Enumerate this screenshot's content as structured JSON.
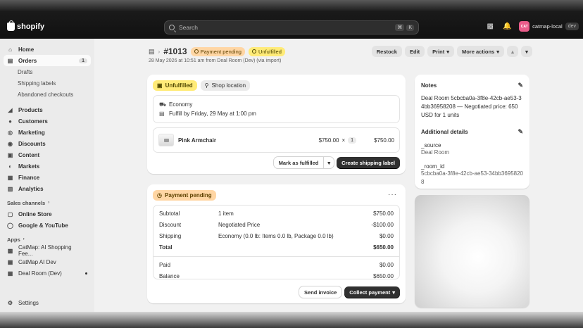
{
  "topbar": {
    "brand": "shopify",
    "search_placeholder": "Search",
    "search_kbd_1": "⌘",
    "search_kbd_2": "K",
    "avatar_initials": "CAT",
    "store_name": "catmap-local",
    "store_badge": "dev"
  },
  "sidebar": {
    "home": "Home",
    "orders": "Orders",
    "orders_count": "1",
    "drafts": "Drafts",
    "shipping_labels": "Shipping labels",
    "abandoned_checkouts": "Abandoned checkouts",
    "products": "Products",
    "customers": "Customers",
    "marketing": "Marketing",
    "discounts": "Discounts",
    "content": "Content",
    "markets": "Markets",
    "finance": "Finance",
    "analytics": "Analytics",
    "sales_channels": "Sales channels",
    "online_store": "Online Store",
    "google_youtube": "Google & YouTube",
    "apps": "Apps",
    "app_1": "CatMap: AI Shopping Fee...",
    "app_2": "CatMap AI Dev",
    "app_3": "Deal Room (Dev)",
    "settings": "Settings"
  },
  "order": {
    "number": "#1013",
    "payment_badge": "Payment pending",
    "fulfillment_badge": "Unfulfilled",
    "meta": "28 May 2026 at 10:51 am from Deal Room (Dev) (via import)"
  },
  "header_actions": {
    "restock": "Restock",
    "edit": "Edit",
    "print": "Print",
    "more_actions": "More actions"
  },
  "fulfillment": {
    "status": "Unfulfilled",
    "location": "Shop location",
    "shipping_method": "Economy",
    "fulfill_by": "Fulfill by Friday, 29 May at 1:00 pm",
    "item_name": "Pink Armchair",
    "item_price": "$750.00",
    "times": "×",
    "item_qty": "1",
    "item_total": "$750.00",
    "mark_fulfilled": "Mark as fulfilled",
    "create_label": "Create shipping label"
  },
  "payment": {
    "status": "Payment pending",
    "rows": [
      {
        "label": "Subtotal",
        "detail": "1 item",
        "amount": "$750.00"
      },
      {
        "label": "Discount",
        "detail": "Negotiated Price",
        "amount": "-$100.00"
      },
      {
        "label": "Shipping",
        "detail": "Economy (0.0 lb: Items 0.0 lb, Package 0.0 lb)",
        "amount": "$0.00"
      },
      {
        "label": "Total",
        "detail": "",
        "amount": "$650.00"
      }
    ],
    "paid_label": "Paid",
    "paid_amount": "$0.00",
    "balance_label": "Balance",
    "balance_amount": "$650.00",
    "send_invoice": "Send invoice",
    "collect_payment": "Collect payment"
  },
  "notes": {
    "title": "Notes",
    "text": "Deal Room 5cbcba0a-3f8e-42cb-ae53-34bb36958208 — Negotiated price: 650 USD for 1 units",
    "details_title": "Additional details",
    "key_1": "_source",
    "val_1": "Deal Room",
    "key_2": "_room_id",
    "val_2": "5cbcba0a-3f8e-42cb-ae53-34bb36958208"
  }
}
